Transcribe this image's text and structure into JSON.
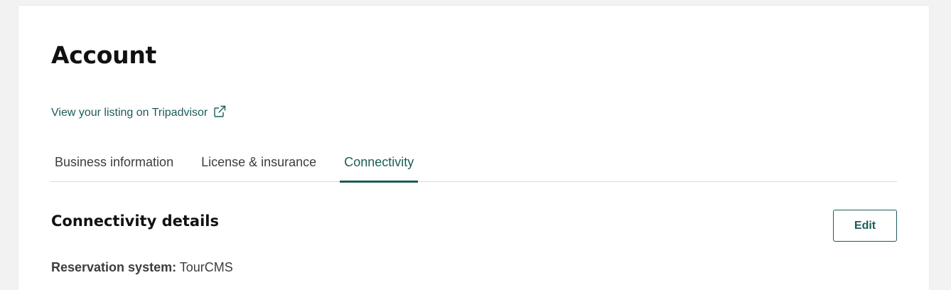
{
  "page": {
    "title": "Account"
  },
  "listing_link": {
    "label": "View your listing on Tripadvisor",
    "icon": "external-link-icon"
  },
  "tabs": [
    {
      "label": "Business information",
      "active": false
    },
    {
      "label": "License & insurance",
      "active": false
    },
    {
      "label": "Connectivity",
      "active": true
    }
  ],
  "section": {
    "title": "Connectivity details",
    "edit_label": "Edit"
  },
  "reservation": {
    "label": "Reservation system:",
    "value": "TourCMS"
  },
  "colors": {
    "accent": "#1b5c58",
    "background": "#f2f2f2",
    "card": "#ffffff",
    "text": "#3d3d3d",
    "heading": "#111111"
  }
}
